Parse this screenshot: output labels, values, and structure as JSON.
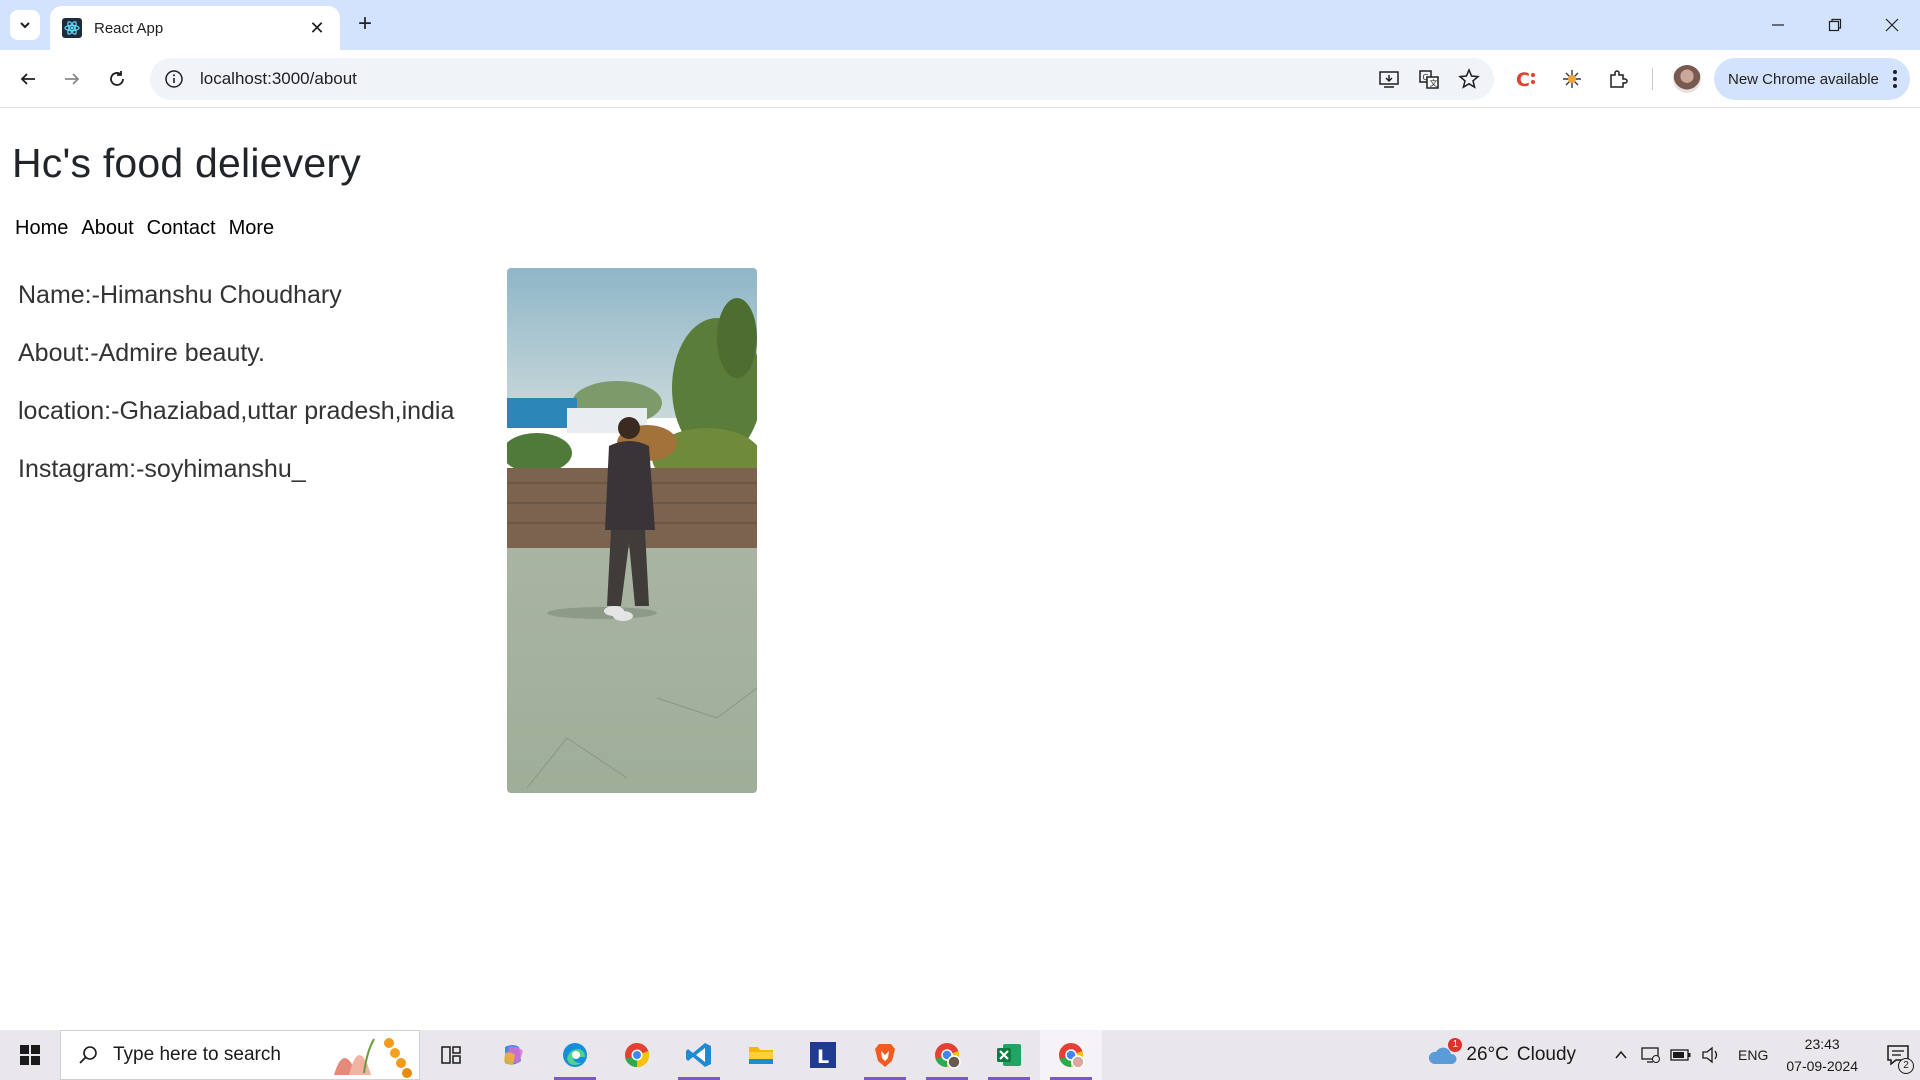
{
  "browser": {
    "tab_title": "React App",
    "url": "localhost:3000/about",
    "update_label": "New Chrome available"
  },
  "site": {
    "title": "Hc's food delievery",
    "nav": [
      "Home",
      "About",
      "Contact",
      "More"
    ],
    "info": [
      "Name:-Himanshu Choudhary",
      "About:-Admire beauty.",
      "location:-Ghaziabad,uttar pradesh,india",
      "Instagram:-soyhimanshu_"
    ]
  },
  "taskbar": {
    "search_placeholder": "Type here to search",
    "weather_temp": "26°C",
    "weather_desc": "Cloudy",
    "weather_alert_count": "1",
    "language": "ENG",
    "time": "23:43",
    "date": "07-09-2024",
    "notification_count": "2",
    "apps": [
      "copilot-icon",
      "edge-icon",
      "chrome-icon",
      "vscode-icon",
      "file-explorer-icon",
      "l-app-icon",
      "brave-icon",
      "chrome-profile-icon",
      "excel-icon",
      "chrome-active-icon"
    ]
  },
  "colors": {
    "tabbar": "#d3e3fd",
    "omnibox": "#f0f4f9",
    "taskbar": "#e9e6ec",
    "accent": "#7a58c8"
  }
}
